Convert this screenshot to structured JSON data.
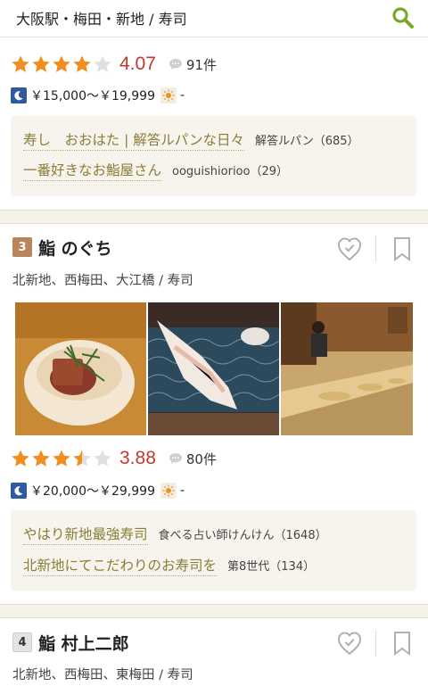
{
  "header": {
    "area_text": "大阪駅・梅田・新地 / 寿司"
  },
  "icons": {
    "search": "search-icon",
    "comment": "comment-bubble-icon",
    "night": "moon-icon",
    "lunch": "sun-icon",
    "visited": "check-heart-icon",
    "save": "bookmark-icon"
  },
  "colors": {
    "accent_green": "#7ba62a",
    "score_red": "#c0392b",
    "star_orange": "#f08e1f",
    "moon_blue": "#2f5aa0",
    "review_olive": "#8b7d3a"
  },
  "listing_prev": {
    "rating": {
      "stars": 4.0,
      "score": "4.07",
      "reviews": "91件"
    },
    "price": {
      "dinner": "￥15,000～￥19,999",
      "lunch": "-"
    },
    "reviews": [
      {
        "title": "寿し　おおはた | 解答ルパンな日々",
        "author": "解答ルパン（685）"
      },
      {
        "title": "一番好きなお鮨屋さん",
        "author": "ooguishiorioo（29）"
      }
    ]
  },
  "listing3": {
    "rank": "3",
    "name": "鮨 のぐち",
    "genre": "北新地、西梅田、大江橋 / 寿司",
    "rating": {
      "stars": 3.5,
      "score": "3.88",
      "reviews": "80件"
    },
    "price": {
      "dinner": "￥20,000～￥29,999",
      "lunch": "-"
    },
    "reviews": [
      {
        "title": "やはり新地最強寿司",
        "author": "食べる占い師けんけん（1648）"
      },
      {
        "title": "北新地にてこだわりのお寿司を",
        "author": "第8世代（134）"
      }
    ]
  },
  "listing4": {
    "rank": "4",
    "name": "鮨 村上二郎",
    "genre": "北新地、西梅田、東梅田 / 寿司"
  }
}
